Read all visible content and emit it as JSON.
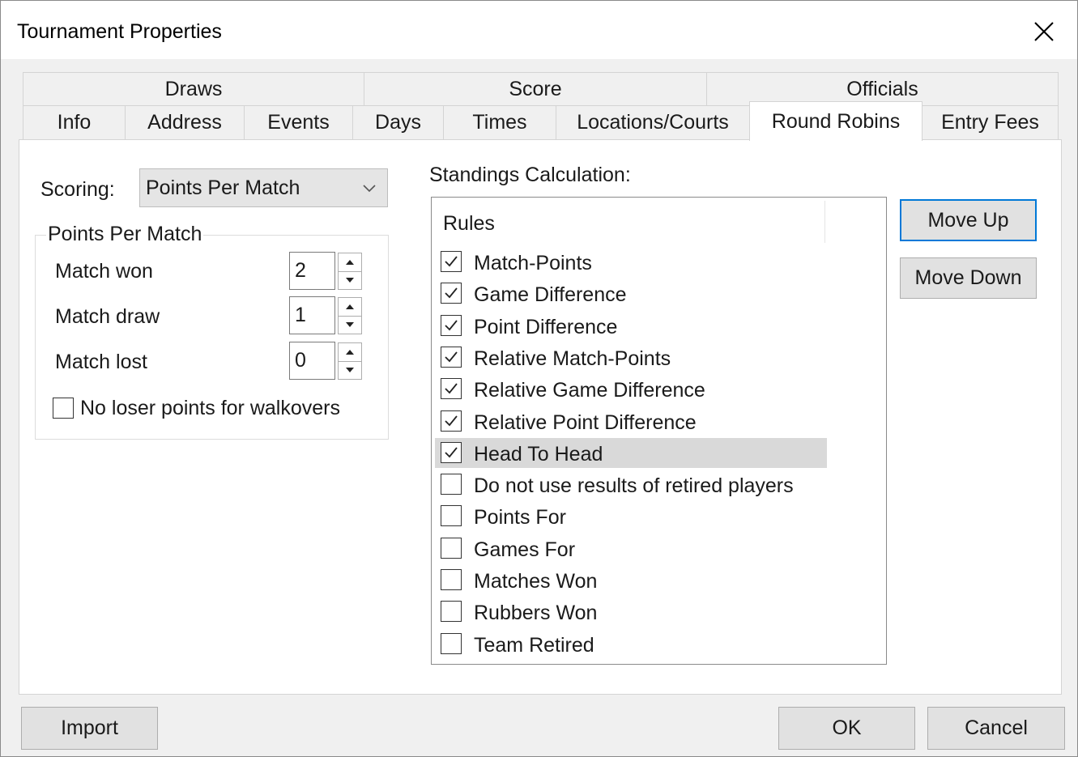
{
  "window": {
    "title": "Tournament Properties"
  },
  "tabs": {
    "row1": [
      {
        "label": "Draws"
      },
      {
        "label": "Score"
      },
      {
        "label": "Officials"
      }
    ],
    "row2": [
      {
        "label": "Info"
      },
      {
        "label": "Address"
      },
      {
        "label": "Events"
      },
      {
        "label": "Days"
      },
      {
        "label": "Times"
      },
      {
        "label": "Locations/Courts"
      },
      {
        "label": "Round Robins",
        "active": true
      },
      {
        "label": "Entry Fees"
      }
    ]
  },
  "scoring": {
    "label": "Scoring:",
    "selected": "Points Per Match"
  },
  "points_group": {
    "legend": "Points Per Match",
    "fields": [
      {
        "label": "Match won",
        "value": "2"
      },
      {
        "label": "Match draw",
        "value": "1"
      },
      {
        "label": "Match lost",
        "value": "0"
      }
    ],
    "no_loser_points": {
      "label": "No loser points for walkovers",
      "checked": false
    }
  },
  "standings": {
    "label": "Standings Calculation:",
    "column_header": "Rules",
    "rules": [
      {
        "label": "Match-Points",
        "checked": true
      },
      {
        "label": "Game Difference",
        "checked": true
      },
      {
        "label": "Point Difference",
        "checked": true
      },
      {
        "label": "Relative Match-Points",
        "checked": true
      },
      {
        "label": "Relative Game Difference",
        "checked": true
      },
      {
        "label": "Relative Point Difference",
        "checked": true
      },
      {
        "label": "Head To Head",
        "checked": true,
        "selected": true
      },
      {
        "label": "Do not use results of retired players",
        "checked": false
      },
      {
        "label": "Points For",
        "checked": false
      },
      {
        "label": "Games For",
        "checked": false
      },
      {
        "label": "Matches Won",
        "checked": false
      },
      {
        "label": "Rubbers Won",
        "checked": false
      },
      {
        "label": "Team Retired",
        "checked": false
      }
    ],
    "move_up_label": "Move Up",
    "move_down_label": "Move Down"
  },
  "footer": {
    "import_label": "Import",
    "ok_label": "OK",
    "cancel_label": "Cancel"
  },
  "colors": {
    "accent": "#0078d7",
    "selection": "#d9d9d9",
    "panel": "#ffffff",
    "chrome": "#f0f0f0"
  },
  "icons": {
    "close": "close-icon",
    "dropdown": "chevron-down-icon",
    "spin_up": "arrow-up-icon",
    "spin_down": "arrow-down-icon",
    "check": "check-icon"
  }
}
